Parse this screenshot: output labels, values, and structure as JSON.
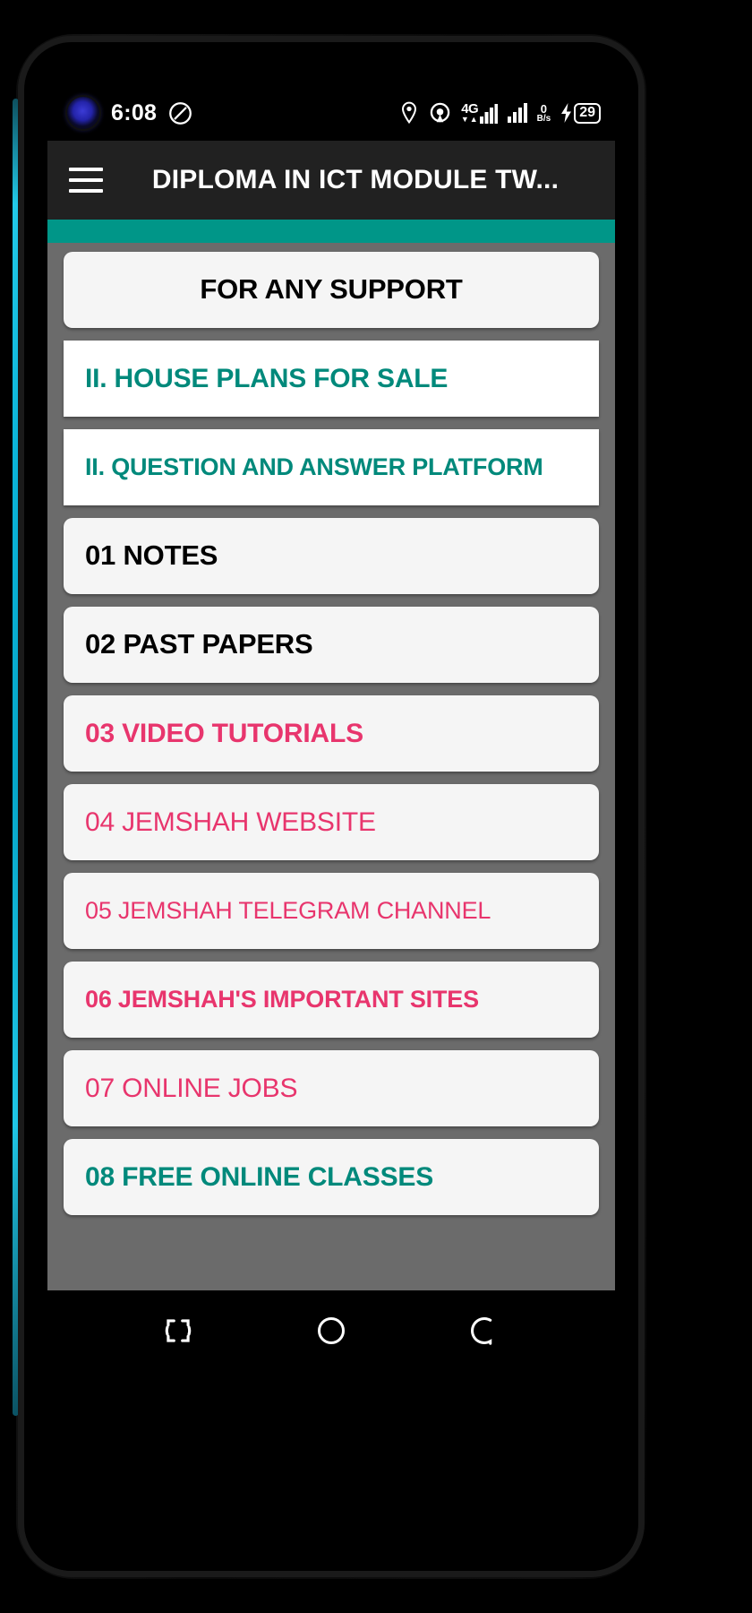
{
  "status_bar": {
    "time": "6:08",
    "dnd_icon": "do-not-disturb-icon",
    "camera_icon": "front-camera-punch-hole",
    "location_icon": "location-pin-icon",
    "location_active_icon": "location-active-icon",
    "network_type": "4G",
    "signal_icon": "signal-bars-icon",
    "net_speed_value": "0",
    "net_speed_unit": "B/s",
    "charging_icon": "charging-bolt-icon",
    "battery_percent": "29"
  },
  "app_bar": {
    "menu_icon": "hamburger-menu-icon",
    "title": "DIPLOMA IN ICT MODULE TW..."
  },
  "accent_color": "#009688",
  "colors": {
    "teal": "#00897b",
    "pink": "#e8356d",
    "black": "#000000",
    "list_background": "#6b6b6b",
    "card_background": "#f5f5f5"
  },
  "list": {
    "items": [
      {
        "label": "FOR ANY SUPPORT",
        "color": "black",
        "weight": "bold",
        "align": "center",
        "shape": "rounded",
        "size": "xl"
      },
      {
        "label": "II. HOUSE PLANS FOR SALE",
        "color": "teal",
        "weight": "bold",
        "align": "left",
        "shape": "square",
        "size": "lg"
      },
      {
        "label": "II. QUESTION AND ANSWER PLATFORM",
        "color": "teal",
        "weight": "bold",
        "align": "left",
        "shape": "square",
        "size": "md"
      },
      {
        "label": "01  NOTES",
        "color": "black",
        "weight": "bold",
        "align": "left",
        "shape": "rounded",
        "size": "xl"
      },
      {
        "label": "02 PAST PAPERS",
        "color": "black",
        "weight": "bold",
        "align": "left",
        "shape": "rounded",
        "size": "xl"
      },
      {
        "label": "03 VIDEO TUTORIALS",
        "color": "pink",
        "weight": "bold",
        "align": "left",
        "shape": "rounded",
        "size": "lg"
      },
      {
        "label": "04 JEMSHAH WEBSITE",
        "color": "pink",
        "weight": "regular",
        "align": "left",
        "shape": "rounded",
        "size": "lg"
      },
      {
        "label": "05 JEMSHAH TELEGRAM CHANNEL",
        "color": "pink",
        "weight": "regular",
        "align": "left",
        "shape": "rounded",
        "size": "md"
      },
      {
        "label": "06 JEMSHAH'S IMPORTANT SITES",
        "color": "pink",
        "weight": "bold",
        "align": "left",
        "shape": "rounded",
        "size": "md"
      },
      {
        "label": "07 ONLINE JOBS",
        "color": "pink",
        "weight": "regular",
        "align": "left",
        "shape": "rounded",
        "size": "lg"
      },
      {
        "label": "08 FREE ONLINE CLASSES",
        "color": "teal",
        "weight": "bold",
        "align": "left",
        "shape": "rounded",
        "size": "lg"
      }
    ]
  },
  "nav_bar": {
    "recents_icon": "recents-icon",
    "home_icon": "home-circle-icon",
    "back_icon": "back-icon"
  }
}
